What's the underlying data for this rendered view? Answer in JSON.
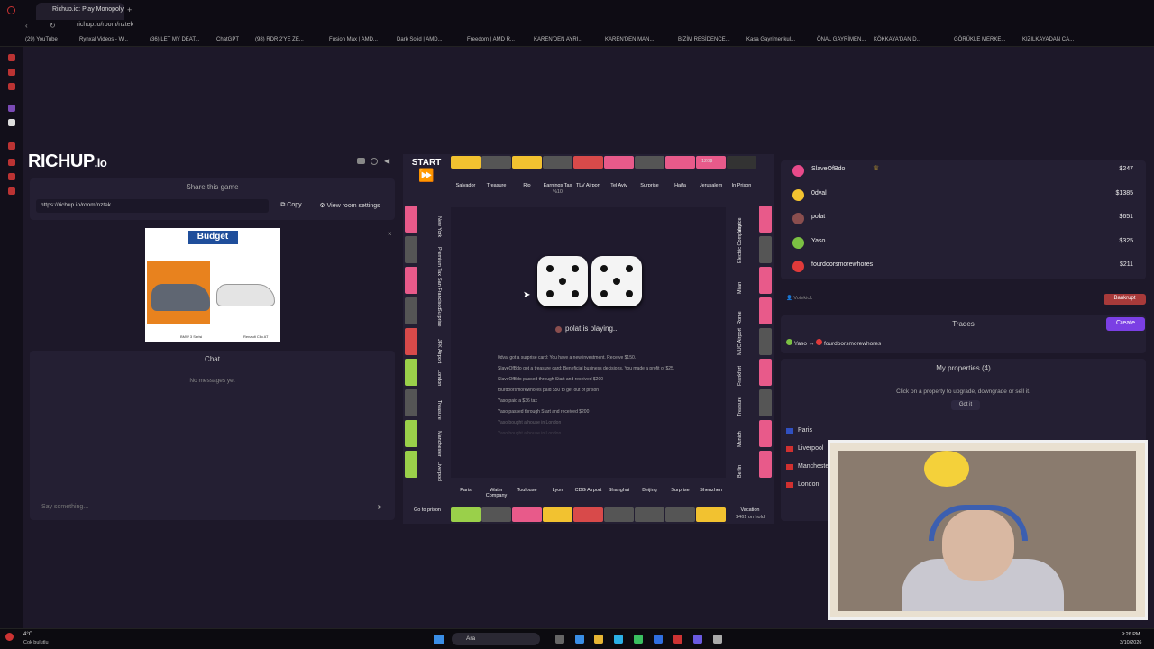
{
  "browser": {
    "tab_title": "Richup.io: Play Monopoly",
    "url": "richup.io/room/nztek",
    "bookmarks": [
      "(29) YouTube",
      "Rynxal Videos - W...",
      "(36) LET MY DEAT...",
      "ChatGPT",
      "(98) RDR 2'YE ZE...",
      "Fusion Max | AMD...",
      "Dark Solid | AMD...",
      "Freedom | AMD R...",
      "KAREN'DEN AYRI...",
      "KAREN'DEN MAN...",
      "BİZİM RESİDENCE...",
      "Kasa Gayrimenkul...",
      "ÖNAL GAYRİMEN...",
      "KÖKKAYA'DAN D...",
      "GÖRÜKLE MERKE...",
      "KIZILKAYADAN CA..."
    ]
  },
  "logo": {
    "main": "RICHUP",
    "suffix": ".io"
  },
  "share": {
    "title": "Share this game",
    "link": "https://richup.io/room/nztek",
    "copy_label": "Copy",
    "room_settings_label": "View room settings"
  },
  "ad": {
    "brand": "Budget",
    "caption_left": "BMW 3 Serisi",
    "caption_right": "Renault Clio AT"
  },
  "chat": {
    "title": "Chat",
    "empty": "No messages yet",
    "placeholder": "Say something..."
  },
  "board": {
    "start_label": "START",
    "top_row": [
      "Salvador",
      "Treasure",
      "Rio",
      "Earnings Tax",
      "TLV Airport",
      "Tel Aviv",
      "Surprise",
      "Haifa",
      "Jerusalem",
      "In Prison"
    ],
    "top_prices": [
      "",
      "",
      "",
      "%10",
      "",
      "",
      "",
      "",
      "",
      ""
    ],
    "left_col": [
      "New York",
      "Premium Tax",
      "San Francisco",
      "Surprise",
      "JFK Airport",
      "London",
      "Treasure",
      "Manchester",
      "Liverpool"
    ],
    "left_prices": [
      "",
      "$75",
      "",
      "",
      "",
      "",
      "",
      "",
      ""
    ],
    "right_col": [
      "Venice",
      "Electric Company",
      "Milan",
      "Rome",
      "MUC Airport",
      "Frankfurt",
      "Treasure",
      "Munich",
      "Berlin"
    ],
    "bottom_row": [
      "Go to prison",
      "Paris",
      "Water Company",
      "Toulouse",
      "Lyon",
      "CDG Airport",
      "Shanghai",
      "Beijing",
      "Surprise",
      "Shenzhen",
      "Vacation"
    ],
    "vacation_amount": "$461 on hold",
    "corner_price": "120$",
    "status": "polat  is playing...",
    "dice": [
      5,
      5
    ],
    "log": [
      "0dval  got a surprise card: You have a new investment. Receive $150.",
      "SlaveOfBdo  got a treasure card: Beneficial business decisions. You made a profit of $25.",
      "SlaveOfBdo  passed through Start and received $200",
      "fourdoorsmorewhores  paid $50 to get out of prison",
      "Yaso  paid a $36 tax",
      "Yaso  passed through Start and received $200",
      "Yaso  bought a house in  London",
      "Yaso  bought a house in  London"
    ]
  },
  "players": [
    {
      "name": "SlaveOfBdo",
      "money": "$247",
      "color": "#e84a8a",
      "crown": true
    },
    {
      "name": "0dval",
      "money": "$1385",
      "color": "#f2c230",
      "crown": false
    },
    {
      "name": "polat",
      "money": "$651",
      "color": "#8a4e4e",
      "crown": false
    },
    {
      "name": "Yaso",
      "money": "$325",
      "color": "#7bc043",
      "crown": false
    },
    {
      "name": "fourdoorsmorewhores",
      "money": "$211",
      "color": "#e03a3a",
      "crown": false
    }
  ],
  "votekick_label": "Votekick",
  "bankrupt_label": "Bankrupt",
  "trades": {
    "title": "Trades",
    "create_label": "Create",
    "left": "Yaso",
    "right": "fourdoorsmorewhores",
    "arrow": "↔"
  },
  "properties": {
    "title": "My properties (4)",
    "hint": "Click on a property to upgrade, downgrade or sell it.",
    "got_it": "Got it",
    "items": [
      "Paris",
      "Liverpool",
      "Manchester",
      "London"
    ]
  },
  "taskbar": {
    "weather_temp": "4°C",
    "weather_desc": "Çok bulutlu",
    "search_label": "Ara",
    "time": "9:26 PM",
    "date": "3/10/2026"
  },
  "colors": {
    "accent": "#7b3fe4",
    "bankrupt": "#a83a3a",
    "yellow_tile": "#f2c230",
    "pink_tile": "#e85a8a",
    "green_tile": "#9ad04a",
    "red_tile": "#d84a4a"
  }
}
